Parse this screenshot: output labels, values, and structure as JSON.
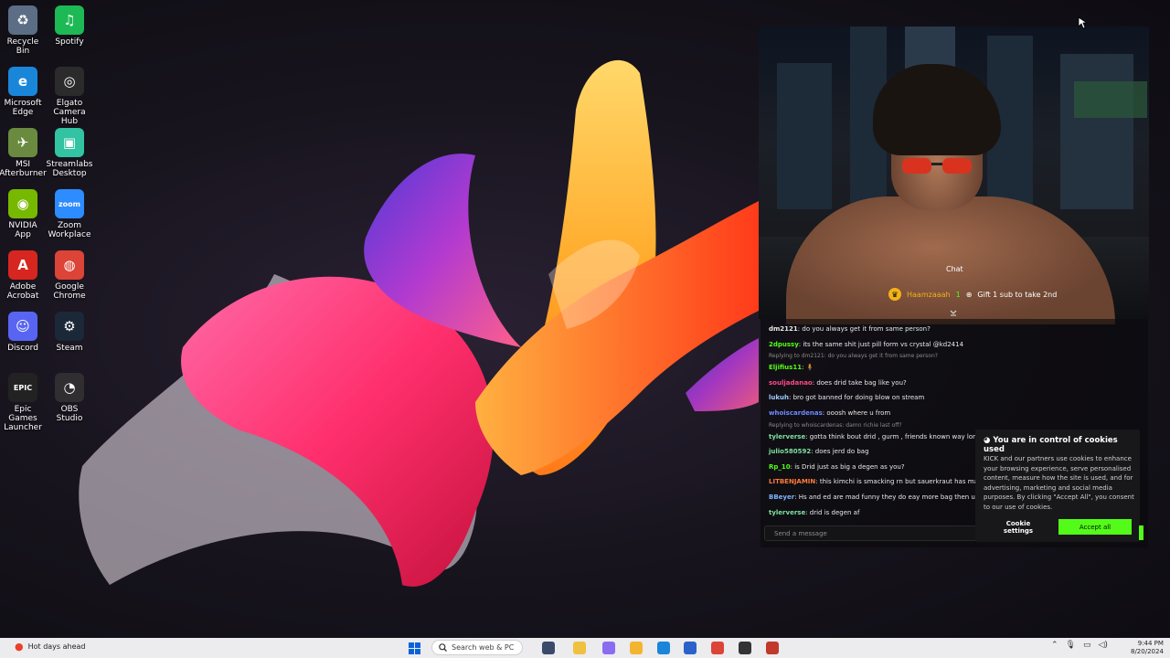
{
  "desktop_icons": [
    {
      "name": "Recycle Bin",
      "glyph": "♻",
      "color": "#5b6e86"
    },
    {
      "name": "Spotify",
      "glyph": "♫",
      "color": "#1db954"
    },
    {
      "name": "Microsoft Edge",
      "glyph": "e",
      "color": "#1a86d9"
    },
    {
      "name": "Elgato Camera Hub",
      "glyph": "◎",
      "color": "#2b2b2b"
    },
    {
      "name": "MSI Afterburner",
      "glyph": "✈",
      "color": "#6a8b3f"
    },
    {
      "name": "Streamlabs Desktop",
      "glyph": "▣",
      "color": "#31c3a2"
    },
    {
      "name": "NVIDIA App",
      "glyph": "◉",
      "color": "#76b900"
    },
    {
      "name": "Zoom Workplace",
      "glyph": "zoom",
      "color": "#2d8cff"
    },
    {
      "name": "Adobe Acrobat",
      "glyph": "A",
      "color": "#d7261f"
    },
    {
      "name": "Google Chrome",
      "glyph": "◍",
      "color": "#db4437"
    },
    {
      "name": "Discord",
      "glyph": "☺",
      "color": "#5865f2"
    },
    {
      "name": "Steam",
      "glyph": "⚙",
      "color": "#1b2838"
    },
    {
      "name": "Epic Games Launcher",
      "glyph": "EPIC",
      "color": "#222222"
    },
    {
      "name": "OBS Studio",
      "glyph": "◔",
      "color": "#302e31"
    }
  ],
  "stream": {
    "overlay_label": "Chat",
    "pinned_user": "Haamzaaah",
    "pinned_count": "1",
    "pinned_text": "Gift 1 sub to take 2nd"
  },
  "chat": {
    "messages": [
      {
        "type": "msg",
        "user": "dm2121",
        "color": "#e8e8e8",
        "text": ": do you always get it from same person?"
      },
      {
        "type": "msg",
        "user": "2dpussy",
        "color": "#53fc18",
        "text": ": its the same shit just pill form vs crystal @kd2414"
      },
      {
        "type": "reply",
        "text": "Replying to dm2121: do you always get it from same person?"
      },
      {
        "type": "msg",
        "user": "Eljifius11",
        "color": "#53fc18",
        "text": ": 🧍"
      },
      {
        "type": "msg",
        "user": "souljadanao",
        "color": "#ff4a8a",
        "text": ": does drid take bag like you?"
      },
      {
        "type": "msg",
        "user": "lukuh",
        "color": "#9ec9ff",
        "text": ": bro got banned for doing blow on stream"
      },
      {
        "type": "msg",
        "user": "whoiscardenas",
        "color": "#6b8cff",
        "text": ": ooosh where u from"
      },
      {
        "type": "reply",
        "text": "Replying to whoiscardenas: damn richie last off?"
      },
      {
        "type": "msg",
        "user": "tylerverse",
        "color": "#7fe0a0",
        "text": ": gotta think bout drid , gurm , friends known way longer"
      },
      {
        "type": "msg",
        "user": "julio580592",
        "color": "#7fe0a0",
        "text": ": does jerd do bag"
      },
      {
        "type": "msg",
        "user": "Rp_10",
        "color": "#53fc18",
        "text": ": is Drid just as big a degen as you?"
      },
      {
        "type": "msg",
        "user": "LITBENJAMIN",
        "color": "#ff7a3d",
        "text": ": this kimchi is smacking rn but sauerkraut has made me"
      },
      {
        "type": "msg",
        "user": "BBeyer",
        "color": "#7fb0ff",
        "text": ": Hs and ed are mad funny they do eay more bag then u. Alleg"
      },
      {
        "type": "msg",
        "user": "tylerverse",
        "color": "#7fe0a0",
        "text": ": drid is degen af"
      }
    ],
    "input_placeholder": "Send a message"
  },
  "cookie": {
    "title": "You are in control of cookies used",
    "body": "KICK and our partners use cookies to enhance your browsing experience, serve personalised content, measure how the site is used, and for advertising, marketing and social media purposes. By clicking \"Accept All\", you consent to our use of cookies.",
    "settings_label": "Cookie settings",
    "accept_label": "Accept all",
    "accent": "#53fc18"
  },
  "taskbar": {
    "weather_text": "Hot days ahead",
    "search_placeholder": "Search web & PC",
    "time": "9:44 PM",
    "date": "8/20/2024",
    "apps": [
      {
        "name": "task-view",
        "color": "#3b4a6b"
      },
      {
        "name": "file-explorer",
        "color": "#f0c040"
      },
      {
        "name": "copilot",
        "color": "#8a6cf0"
      },
      {
        "name": "folder",
        "color": "#f3b52f"
      },
      {
        "name": "edge",
        "color": "#1a86d9"
      },
      {
        "name": "store",
        "color": "#2a62c9"
      },
      {
        "name": "chrome",
        "color": "#db4437"
      },
      {
        "name": "terminal",
        "color": "#333333"
      },
      {
        "name": "record",
        "color": "#c0392b"
      }
    ]
  }
}
